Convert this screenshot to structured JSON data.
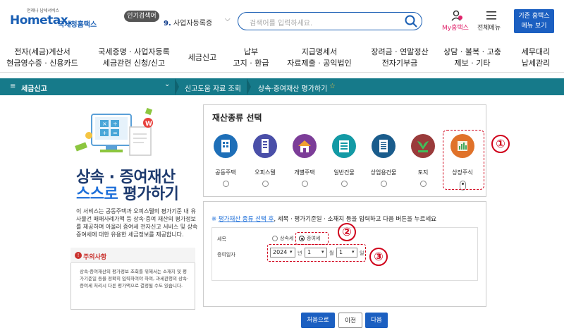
{
  "header": {
    "logo_small": "언제나 납세서비스",
    "logo_main": "Hometax.",
    "logo_kr": "국세청홈택스",
    "popular_badge": "인기검색어",
    "popular_rank": "9.",
    "popular_term": "사업자등록증",
    "search_placeholder": "검색어를 입력하세요.",
    "my_label": "My홈택스",
    "menu_label": "전체메뉴",
    "home_button_line1": "기존 홈택스",
    "home_button_line2": "메뉴 보기"
  },
  "nav": [
    {
      "line1": "전자(세금)계산서",
      "line2": "현금영수증 · 신용카드"
    },
    {
      "line1": "국세증명 · 사업자등록",
      "line2": "세금관련 신청/신고"
    },
    {
      "line1": "세금신고",
      "line2": ""
    },
    {
      "line1": "납부",
      "line2": "고지 · 환급"
    },
    {
      "line1": "지급명세서",
      "line2": "자료제출 · 공익법인"
    },
    {
      "line1": "장려금 · 연말정산",
      "line2": "전자기부금"
    },
    {
      "line1": "상담 · 불복 · 고충",
      "line2": "제보 · 기타"
    },
    {
      "line1": "세무대리",
      "line2": "납세관리"
    }
  ],
  "breadcrumb": {
    "menu_icon": "≡",
    "section": "세금신고",
    "chev": "⌄",
    "level2": "신고도움 자료 조회",
    "level3": "상속·증여재산 평가하기",
    "star": "☆"
  },
  "left": {
    "title_line1": "상속 · 증여재산",
    "title_line2a": "스스로 ",
    "title_line2b": "평가하기",
    "description": "이 서비스는 공동주택과 오피스텔의 평가기준 내 유사물건 매매사례가액 등 상속·증여 재산의 평가정보를 제공하며 아울러 증여세 전자신고 서비스 및 상속증여세에 대한 유용한 세금정보를 제공합니다.",
    "notice_title": "주의사항",
    "notice_body": "상속·증여재산의 평가정보 조회를 위해서는 소재지 및 평가기준일 등을 정확히 입력하여야 하며, 과세관청의 상속·증여세 처리시 다른 평가액으로 결정될 수도 있습니다."
  },
  "asset_panel": {
    "title": "재산종류 선택",
    "items": [
      {
        "label": "공동주택",
        "color": "#1e6fb8",
        "icon": "apartment-icon",
        "selected": false
      },
      {
        "label": "오피스텔",
        "color": "#4a4fa8",
        "icon": "officetel-icon",
        "selected": false
      },
      {
        "label": "개별주택",
        "color": "#7c3d98",
        "icon": "house-icon",
        "selected": false
      },
      {
        "label": "일반건물",
        "color": "#139aa5",
        "icon": "building-icon",
        "selected": false
      },
      {
        "label": "상업용건물",
        "color": "#1a5c8c",
        "icon": "commercial-icon",
        "selected": false
      },
      {
        "label": "토지",
        "color": "#9a3b3b",
        "icon": "land-icon",
        "selected": false
      },
      {
        "label": "상장주식",
        "color": "#e0722a",
        "icon": "stock-icon",
        "selected": true
      }
    ]
  },
  "form_panel": {
    "instr_prefix": "※ ",
    "instr_link": "평가재산 종류 선택 후",
    "instr_rest": ", 세목 · 평가기준일 · 소재지 등을 입력하고 다음 버튼을 누르세요",
    "tax_label": "세목",
    "tax_options": [
      "상속세",
      "증여세"
    ],
    "tax_selected": "증여세",
    "date_label": "증여일자",
    "year": "2024",
    "year_unit": "년",
    "month": "1",
    "month_unit": "월",
    "day": "1",
    "day_unit": "일"
  },
  "callouts": [
    "①",
    "②",
    "③"
  ],
  "buttons": {
    "first": "처음으로",
    "prev": "이전",
    "next": "다음"
  }
}
